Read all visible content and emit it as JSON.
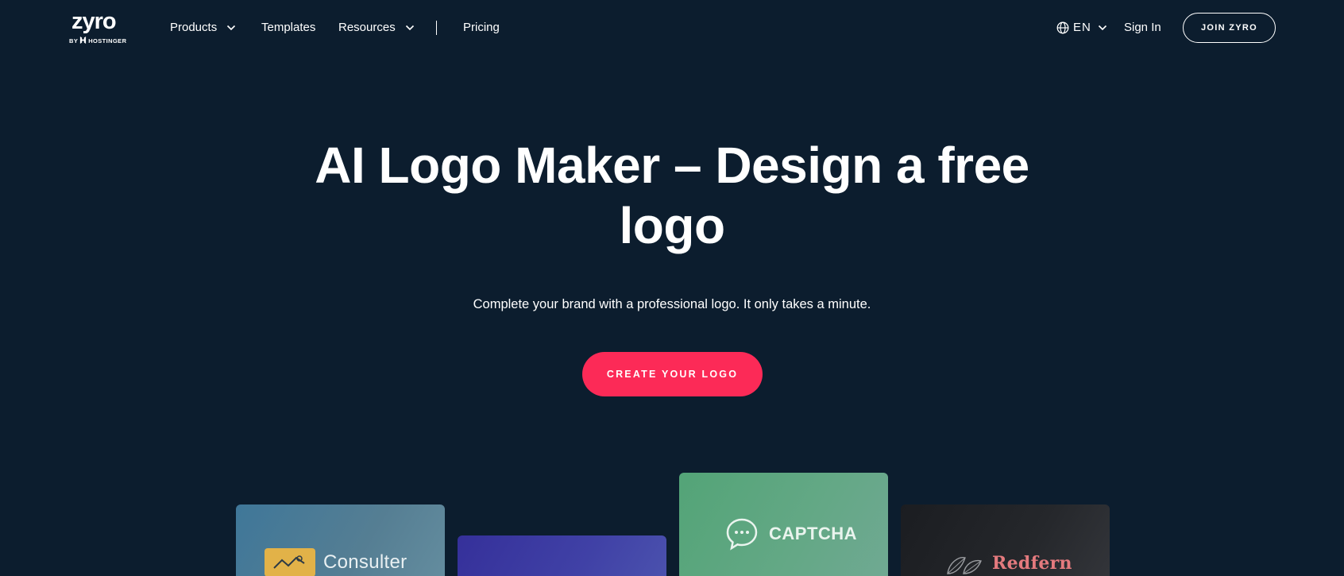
{
  "brand": {
    "name": "zyro",
    "by_prefix": "BY",
    "by_company": "HOSTINGER"
  },
  "nav": {
    "items": [
      {
        "label": "Products"
      },
      {
        "label": "Templates"
      },
      {
        "label": "Resources"
      },
      {
        "label": "Pricing"
      }
    ],
    "language": "EN",
    "sign_in": "Sign In",
    "join": "JOIN ZYRO"
  },
  "hero": {
    "title": "AI Logo Maker – Design a free logo",
    "subtitle": "Complete your brand with a professional logo. It only takes a minute.",
    "cta": "CREATE YOUR LOGO"
  },
  "logo_examples": [
    {
      "name": "Consulter",
      "color": "#3f7799"
    },
    {
      "name": "",
      "color": "#35309a"
    },
    {
      "name": "CAPTCHA",
      "color": "#53a477"
    },
    {
      "name": "Redfern",
      "color": "#1b1d21"
    }
  ],
  "colors": {
    "background": "#0c1d2e",
    "accent": "#fc2a57",
    "text": "#ffffff"
  }
}
